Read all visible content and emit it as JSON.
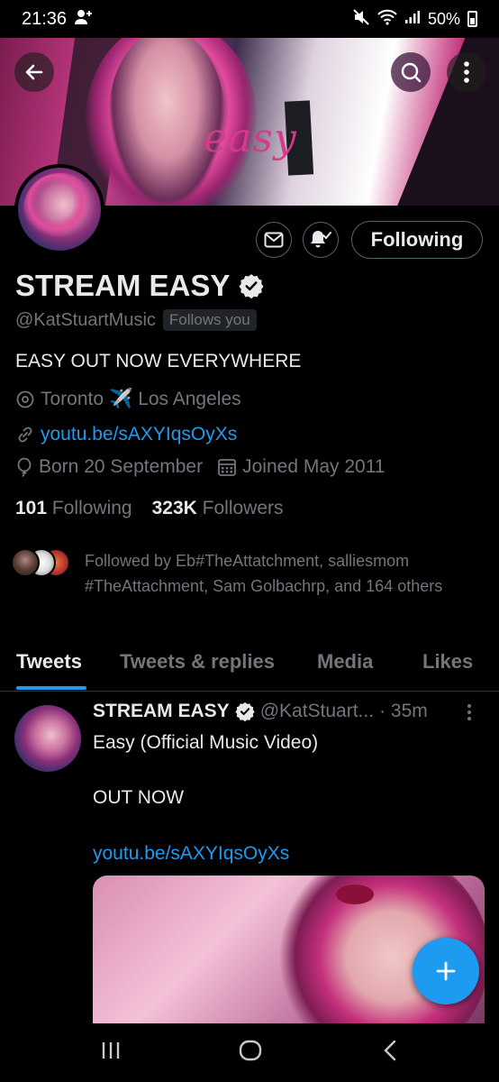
{
  "status_bar": {
    "time": "21:36",
    "battery": "50%",
    "icons": [
      "person-add-icon",
      "silent-icon",
      "wifi-icon",
      "signal-icon",
      "battery-icon"
    ]
  },
  "banner": {
    "word": "easy"
  },
  "profile": {
    "display_name": "STREAM EASY",
    "handle": "@KatStuartMusic",
    "follows_you": "Follows you",
    "bio": "EASY OUT NOW EVERYWHERE",
    "location_from": "Toronto",
    "location_emoji": "✈️",
    "location_to": "Los Angeles",
    "link": "youtu.be/sAXYIqsOyXs",
    "born": "Born 20 September",
    "joined": "Joined May 2011",
    "following_count": "101",
    "following_label": "Following",
    "followers_count": "323K",
    "followers_label": "Followers",
    "followed_by": "Followed by Eb#TheAttatchment, salliesmom #TheAttachment, Sam Golbachrp, and 164 others"
  },
  "actions": {
    "following_button": "Following"
  },
  "tabs": [
    {
      "label": "Tweets",
      "active": true
    },
    {
      "label": "Tweets & replies",
      "active": false
    },
    {
      "label": "Media",
      "active": false
    },
    {
      "label": "Likes",
      "active": false
    }
  ],
  "tweet": {
    "name": "STREAM EASY",
    "handle": "@KatStuart...",
    "time": "· 35m",
    "line1": "Easy (Official Music Video)",
    "line2": "OUT NOW",
    "link": "youtu.be/sAXYIqsOyXs"
  },
  "colors": {
    "accent": "#1d9bf0",
    "muted": "#71767b",
    "text": "#e7e9ea",
    "background": "#000000"
  }
}
